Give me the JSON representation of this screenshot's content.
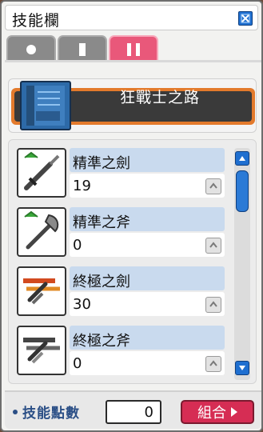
{
  "window": {
    "title": "技能欄"
  },
  "tabs": [
    {
      "label": "○",
      "active": false
    },
    {
      "label": "Ⅰ",
      "active": false
    },
    {
      "label": "Ⅱ",
      "active": true
    }
  ],
  "job": {
    "name": "狂戰士之路"
  },
  "skills": [
    {
      "name": "精準之劍",
      "level": "19",
      "icon": "sword-icon"
    },
    {
      "name": "精準之斧",
      "level": "0",
      "icon": "axe-icon"
    },
    {
      "name": "終極之劍",
      "level": "30",
      "icon": "final-sword-icon"
    },
    {
      "name": "終極之斧",
      "level": "0",
      "icon": "final-axe-icon"
    }
  ],
  "footer": {
    "sp_label": "技能點數",
    "sp_value": "0",
    "combine_label": "組合"
  },
  "colors": {
    "accent": "#e9587a",
    "job_banner": "#e37a2c",
    "skill_name_bar": "#c9daee",
    "button_blue": "#1f6fd0"
  }
}
